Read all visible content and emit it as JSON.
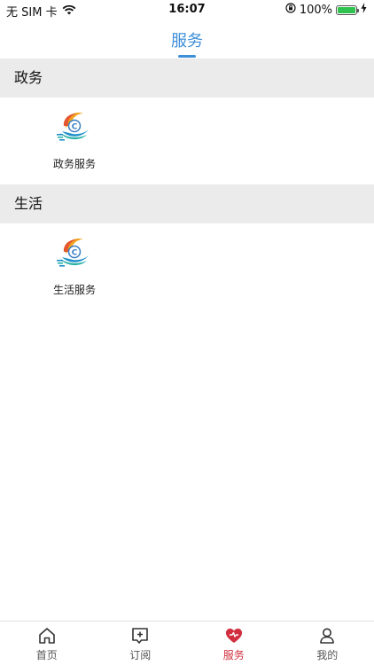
{
  "status_bar": {
    "carrier": "无 SIM 卡",
    "time": "16:07",
    "battery": "100%",
    "battery_level": 1.0,
    "icons": [
      "wifi-icon",
      "orientation-lock-icon",
      "battery-icon",
      "charging-icon"
    ]
  },
  "header": {
    "title": "服务"
  },
  "sections": [
    {
      "title": "政务",
      "items": [
        {
          "label": "政务服务",
          "icon": "service-logo-icon"
        }
      ]
    },
    {
      "title": "生活",
      "items": [
        {
          "label": "生活服务",
          "icon": "service-logo-icon"
        }
      ]
    }
  ],
  "tab_bar": {
    "tabs": [
      {
        "label": "首页",
        "icon": "home-icon"
      },
      {
        "label": "订阅",
        "icon": "subscribe-icon"
      },
      {
        "label": "服务",
        "icon": "heart-icon",
        "active": true
      },
      {
        "label": "我的",
        "icon": "user-icon"
      }
    ]
  },
  "colors": {
    "accent": "#3d8fd8",
    "tab_active": "#d12f3f",
    "section_bg": "#ebebeb",
    "battery": "#2fc24f"
  }
}
